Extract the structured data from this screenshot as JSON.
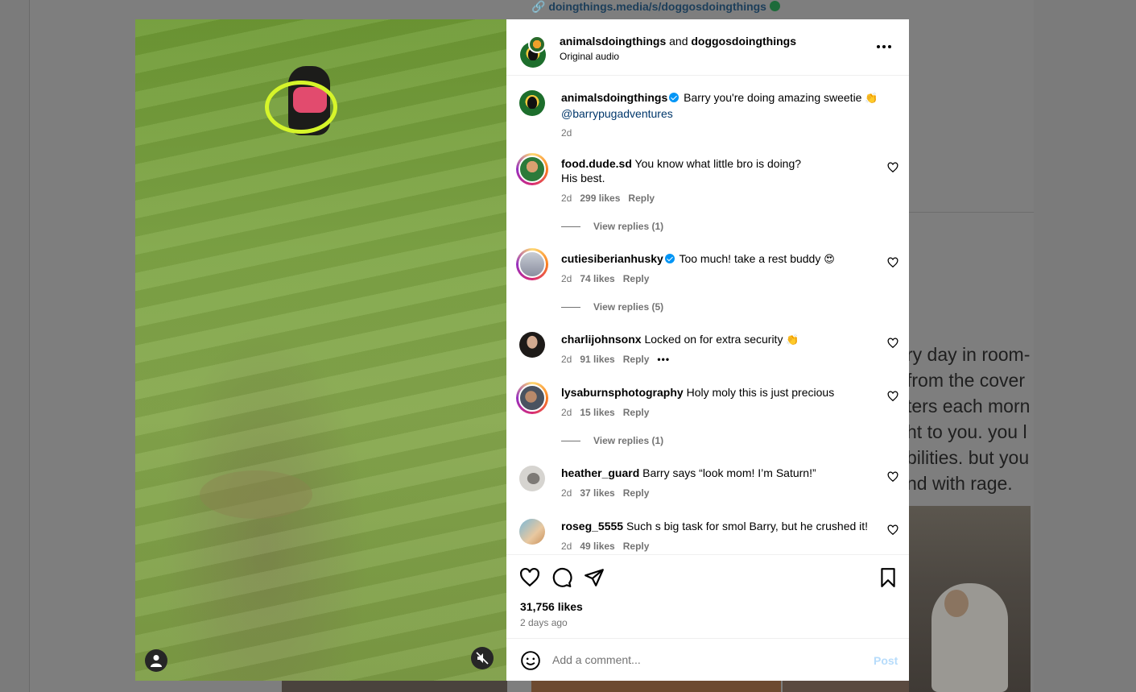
{
  "background": {
    "link_text": "doingthings.media/s/doggosdoingthings",
    "article_lines": [
      "ry day in room-",
      "from the cover",
      "ters each morn",
      "ht to you. you l",
      "bilities. but you",
      "nd with rage."
    ]
  },
  "post": {
    "header": {
      "account_1": "animalsdoingthings",
      "conjunction": "and",
      "account_2": "doggosdoingthings",
      "audio": "Original audio"
    },
    "caption": {
      "user": "animalsdoingthings",
      "text": "Barry you're doing amazing sweetie",
      "emoji": "👏",
      "mention": "@barrypugadventures",
      "time": "2d"
    },
    "comments": [
      {
        "user": "food.dude.sd",
        "verified": false,
        "text": "You know what little bro is doing?",
        "text2": "His best.",
        "emoji": "",
        "time": "2d",
        "likes": "299 likes",
        "reply": "Reply",
        "view_replies": "View replies (1)"
      },
      {
        "user": "cutiesiberianhusky",
        "verified": true,
        "text": "Too much! take a rest buddy",
        "emoji": "😍",
        "time": "2d",
        "likes": "74 likes",
        "reply": "Reply",
        "view_replies": "View replies (5)"
      },
      {
        "user": "charlijohnsonx",
        "verified": false,
        "text": "Locked on for extra security",
        "emoji": "👏",
        "time": "2d",
        "likes": "91 likes",
        "reply": "Reply",
        "more": "•••"
      },
      {
        "user": "lysaburnsphotography",
        "verified": false,
        "text": "Holy moly this is just precious",
        "emoji": "",
        "time": "2d",
        "likes": "15 likes",
        "reply": "Reply",
        "view_replies": "View replies (1)"
      },
      {
        "user": "heather_guard",
        "verified": false,
        "text": "Barry says “look mom! I’m Saturn!”",
        "emoji": "",
        "time": "2d",
        "likes": "37 likes",
        "reply": "Reply"
      },
      {
        "user": "roseg_5555",
        "verified": false,
        "text": "Such s big task for smol Barry, but he crushed it!",
        "emoji": "",
        "time": "2d",
        "likes": "49 likes",
        "reply": "Reply"
      }
    ],
    "likes_count": "31,756 likes",
    "posted": "2 days ago",
    "composer": {
      "placeholder": "Add a comment...",
      "post_label": "Post"
    }
  },
  "icons": {
    "more": "more-options-icon",
    "like": "heart-icon",
    "comment": "comment-icon",
    "share": "share-icon",
    "save": "bookmark-icon",
    "emoji": "emoji-icon",
    "mute": "muted-audio-icon",
    "tag": "user-tag-icon"
  },
  "colors": {
    "verified": "#0095f6",
    "mention": "#00376b",
    "secondary_text": "#737373",
    "post_disabled": "#b7dcfb"
  }
}
